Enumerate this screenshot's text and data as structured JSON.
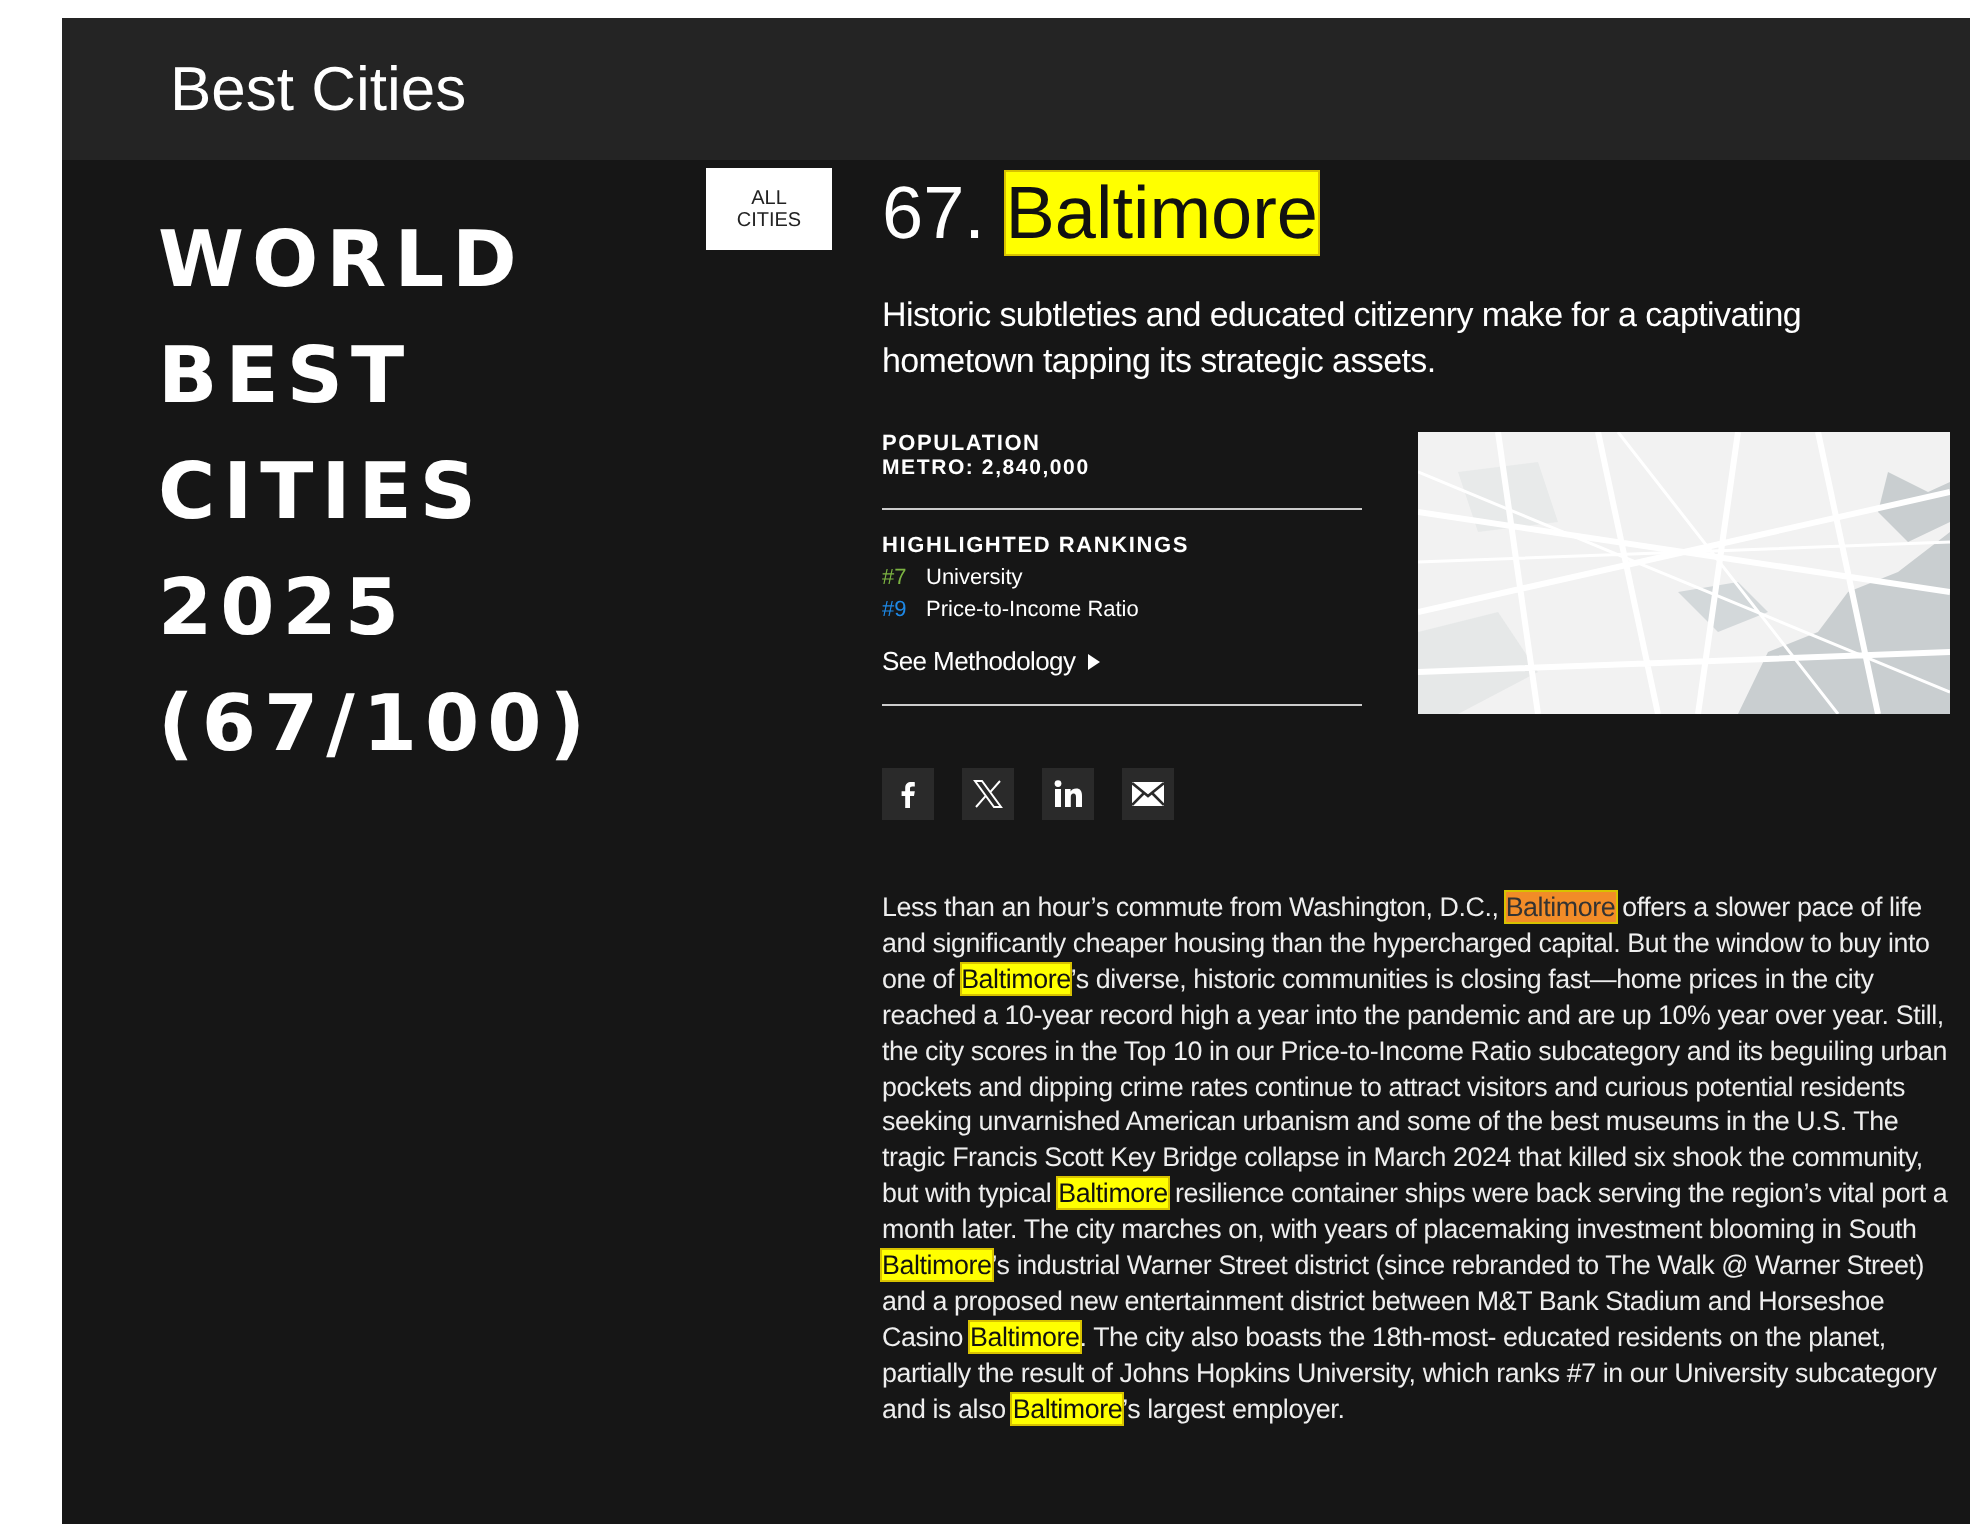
{
  "header": {
    "title": "Best Cities"
  },
  "side_title": [
    "WORLD",
    "BEST",
    "CITIES",
    "2025",
    "(67/100)"
  ],
  "all_cities_button": {
    "lines": [
      "ALL",
      "CITIES"
    ]
  },
  "city": {
    "rank": "67.",
    "name": "Baltimore",
    "highlighted": true
  },
  "tagline": "Historic subtleties and educated citizenry make for a captivating hometown tapping its strategic assets.",
  "population": {
    "label": "POPULATION",
    "value": "METRO: 2,840,000"
  },
  "rankings": {
    "title": "HIGHLIGHTED RANKINGS",
    "items": [
      {
        "rank": "#7",
        "label": "University",
        "color": "#7cb342"
      },
      {
        "rank": "#9",
        "label": "Price-to-Income Ratio",
        "color": "#1e88e5"
      }
    ]
  },
  "methodology_link": "See Methodology",
  "share_buttons": [
    {
      "kind": "facebook"
    },
    {
      "kind": "x"
    },
    {
      "kind": "linkedin"
    },
    {
      "kind": "email"
    }
  ],
  "body": [
    {
      "text": "Less than an hour’s commute from Washington, D.C., ",
      "highlighted": false,
      "current": false
    },
    {
      "text": "Baltimore",
      "highlighted": true,
      "current": true
    },
    {
      "text": " offers a slower pace of life and significantly cheaper housing than the hypercharged capital. But the window to buy into one of ",
      "highlighted": false,
      "current": false
    },
    {
      "text": "Baltimore",
      "highlighted": true,
      "current": false
    },
    {
      "text": "’s diverse, historic communities is closing fast—home prices in the city reached a 10-year record high a year into the pandemic and are up 10% year over year. Still, the city scores in the Top 10 in our Price-to-Income Ratio subcategory and its beguiling urban pockets and dipping crime rates continue to attract visitors and curious potential residents seeking unvarnished American urbanism and some of the best museums in the U.S. The tragic Francis Scott Key Bridge collapse in March 2024 that killed six shook the community, but with typical ",
      "highlighted": false,
      "current": false
    },
    {
      "text": "Baltimore",
      "highlighted": true,
      "current": false
    },
    {
      "text": " resilience container ships were back serving the region’s vital port a month later. The city marches on, with years of placemaking investment blooming in South ",
      "highlighted": false,
      "current": false
    },
    {
      "text": "Baltimore",
      "highlighted": true,
      "current": false
    },
    {
      "text": "’s industrial Warner Street district (since rebranded to The Walk @ Warner Street) and a proposed new entertainment district between M&T Bank Stadium and Horseshoe Casino ",
      "highlighted": false,
      "current": false
    },
    {
      "text": "Baltimore",
      "highlighted": true,
      "current": false
    },
    {
      "text": ". The city also boasts the 18th-most- educated residents on the planet, partially the result of Johns Hopkins University, which ranks #7 in our University subcategory and is also ",
      "highlighted": false,
      "current": false
    },
    {
      "text": "Baltimore",
      "highlighted": true,
      "current": false
    },
    {
      "text": "’s largest employer.",
      "highlighted": false,
      "current": false
    }
  ]
}
